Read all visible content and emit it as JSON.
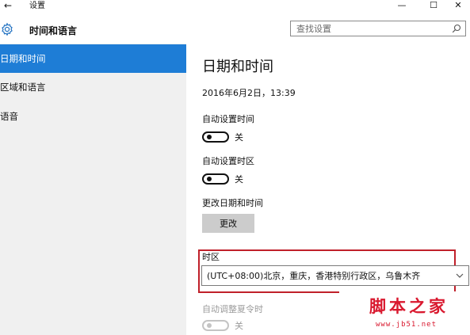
{
  "window": {
    "title": "设置",
    "back_glyph": "←",
    "minimize_glyph": "—",
    "maximize_glyph": "☐",
    "close_glyph": "✕"
  },
  "header": {
    "app_title": "时间和语言",
    "icon": "gear-icon"
  },
  "search": {
    "placeholder": "查找设置",
    "icon": "search-icon"
  },
  "sidebar": {
    "items": [
      {
        "label": "日期和时间",
        "active": true
      },
      {
        "label": "区域和语言",
        "active": false
      },
      {
        "label": "语音",
        "active": false
      }
    ]
  },
  "main": {
    "title": "日期和时间",
    "current_datetime": "2016年6月2日，13:39",
    "auto_time": {
      "label": "自动设置时间",
      "state_text": "关"
    },
    "auto_timezone": {
      "label": "自动设置时区",
      "state_text": "关"
    },
    "change_datetime": {
      "label": "更改日期和时间",
      "button_label": "更改"
    },
    "timezone": {
      "label": "时区",
      "value": "(UTC+08:00)北京，重庆，香港特别行政区，乌鲁木齐"
    },
    "dst": {
      "label": "自动调整夏令时",
      "state_text": "关"
    }
  },
  "watermark": {
    "title": "脚本之家",
    "url": "www.jb51.net"
  },
  "colors": {
    "accent": "#1e7dd6",
    "sidebar_bg": "#f0f0f0",
    "highlight": "#c0202a",
    "watermark": "#d9182e"
  }
}
